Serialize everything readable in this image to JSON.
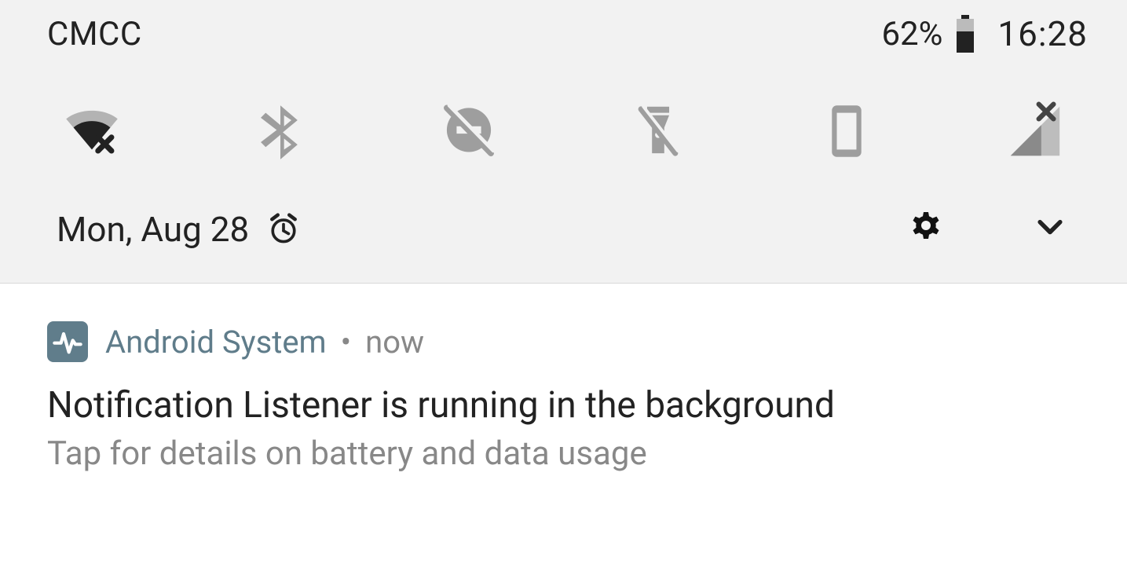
{
  "status": {
    "carrier": "CMCC",
    "battery_percent": "62%",
    "clock": "16:28",
    "battery_level_ratio": 0.62
  },
  "quick_settings": {
    "toggles": [
      {
        "name": "wifi-toggle",
        "icon": "wifi-error-icon",
        "active": true
      },
      {
        "name": "bluetooth-toggle",
        "icon": "bluetooth-icon",
        "active": false
      },
      {
        "name": "dnd-toggle",
        "icon": "do-not-disturb-off-icon",
        "active": false
      },
      {
        "name": "flashlight-toggle",
        "icon": "flashlight-off-icon",
        "active": false
      },
      {
        "name": "portrait-toggle",
        "icon": "portrait-icon",
        "active": false
      },
      {
        "name": "cellular-toggle",
        "icon": "signal-no-data-icon",
        "active": false
      }
    ]
  },
  "date_bar": {
    "date": "Mon, Aug 28",
    "has_alarm": true
  },
  "notification": {
    "app_name": "Android System",
    "time": "now",
    "title": "Notification Listener is running in the background",
    "body": "Tap for details on battery and data usage",
    "accent": "#607d8b"
  }
}
